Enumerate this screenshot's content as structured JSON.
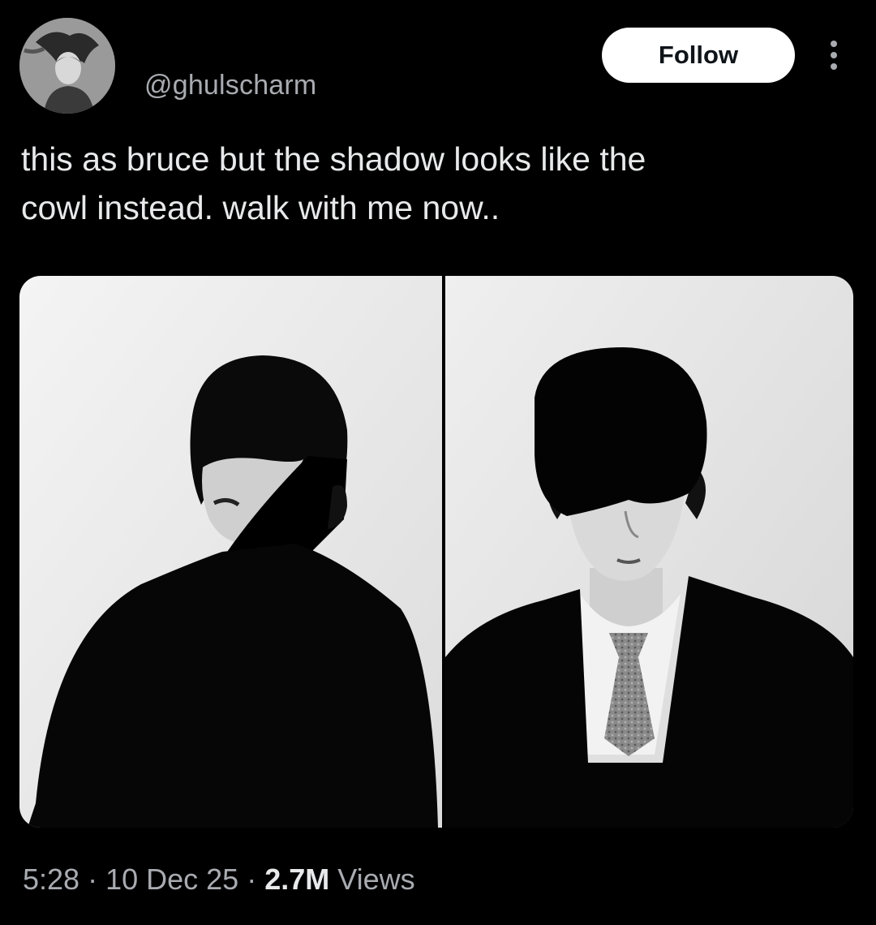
{
  "author": {
    "handle": "@ghulscharm",
    "avatar_icon": "avatar-photo"
  },
  "header": {
    "follow_label": "Follow",
    "more_icon": "more-vertical-icon"
  },
  "tweet": {
    "text_lines": [
      "this as bruce but the shadow looks like the",
      "cowl instead. walk with me now.."
    ]
  },
  "media": {
    "photos": [
      {
        "id": "left",
        "description_icon": "photo-left"
      },
      {
        "id": "right",
        "description_icon": "photo-right"
      }
    ]
  },
  "meta": {
    "time": "5:28",
    "date": "10 Dec 25",
    "views_count": "2.7M",
    "views_label": "Views",
    "separator": "·"
  },
  "colors": {
    "background": "#000000",
    "text_primary": "#e7e9ea",
    "text_secondary": "#a8abb0",
    "follow_bg": "#ffffff",
    "follow_text": "#0f1419"
  }
}
